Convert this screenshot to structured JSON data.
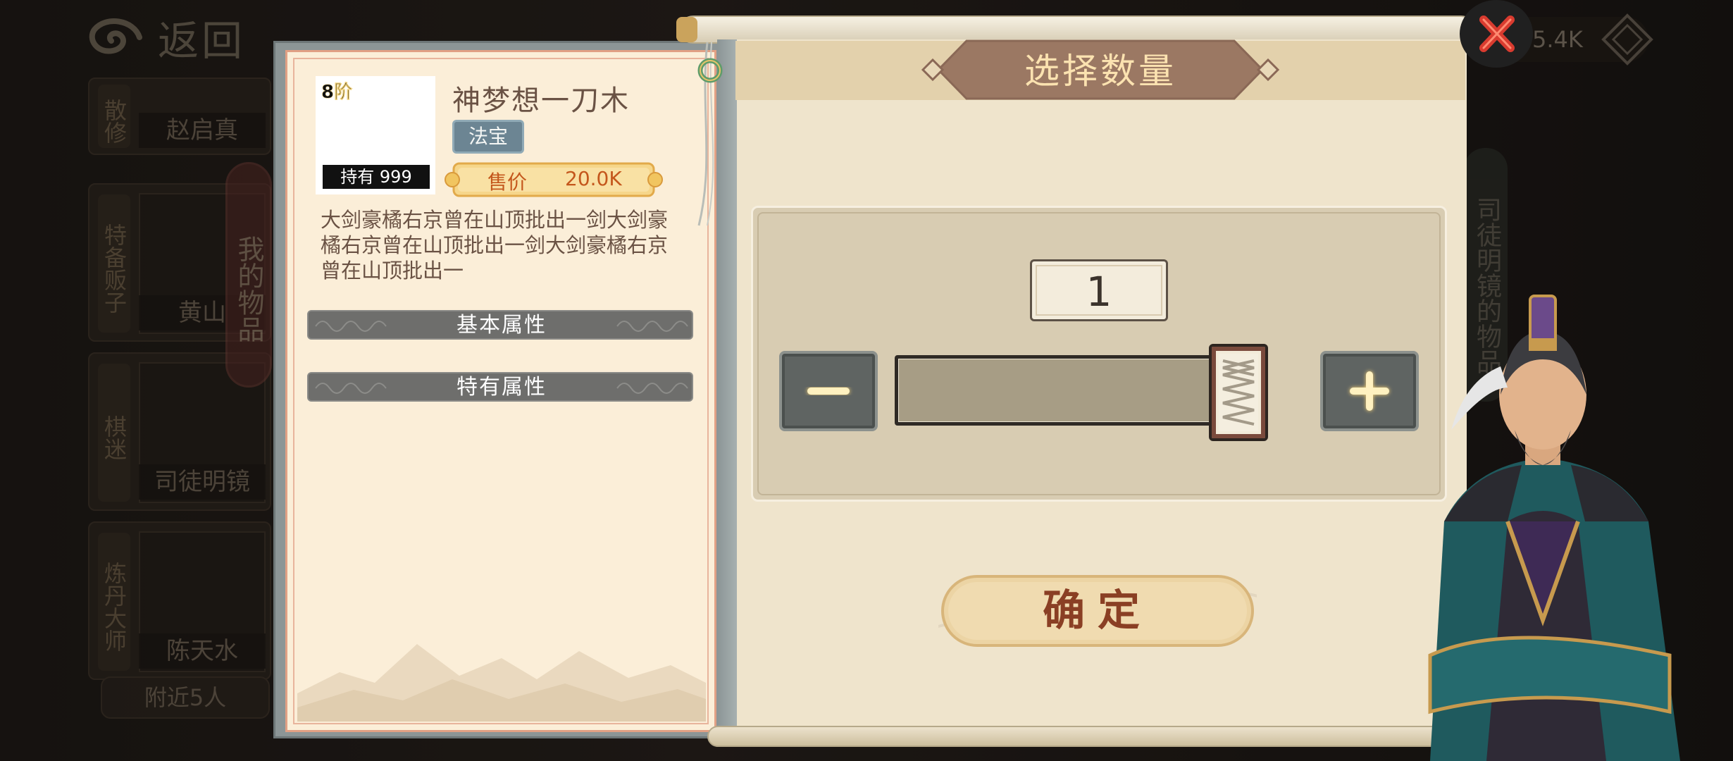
{
  "background": {
    "back_label": "返回",
    "npcs": [
      {
        "tag": "散修",
        "name": "赵启真"
      },
      {
        "tag": "特备贩子",
        "name": "黄山"
      },
      {
        "tag": "棋迷",
        "name": "司徒明镜"
      },
      {
        "tag": "炼丹大师",
        "name": "陈天水"
      }
    ],
    "nearby_label": "附近5人",
    "my_items_tab": "我的物品",
    "right_tab": "司徒明镜的物品",
    "currency_value": "5.4K"
  },
  "item": {
    "tier": "8阶",
    "owned": "持有 999",
    "name": "神梦想一刀木",
    "type": "法宝",
    "price_label": "售价",
    "price_value": "20.0K",
    "description": "大剑豪橘右京曾在山顶批出一剑大剑豪橘右京曾在山顶批出一剑大剑豪橘右京曾在山顶批出一",
    "attr_sections": [
      "基本属性",
      "特有属性"
    ]
  },
  "dialog": {
    "title": "选择数量",
    "quantity": "1",
    "slider_level": 1.0,
    "confirm_label": "确定"
  },
  "colors": {
    "accent_brown": "#8a3f24",
    "title_plate": "#9b7863",
    "price_orange": "#c4571c",
    "close_red": "#d93b2f",
    "glyph_gold": "#ffd878"
  }
}
